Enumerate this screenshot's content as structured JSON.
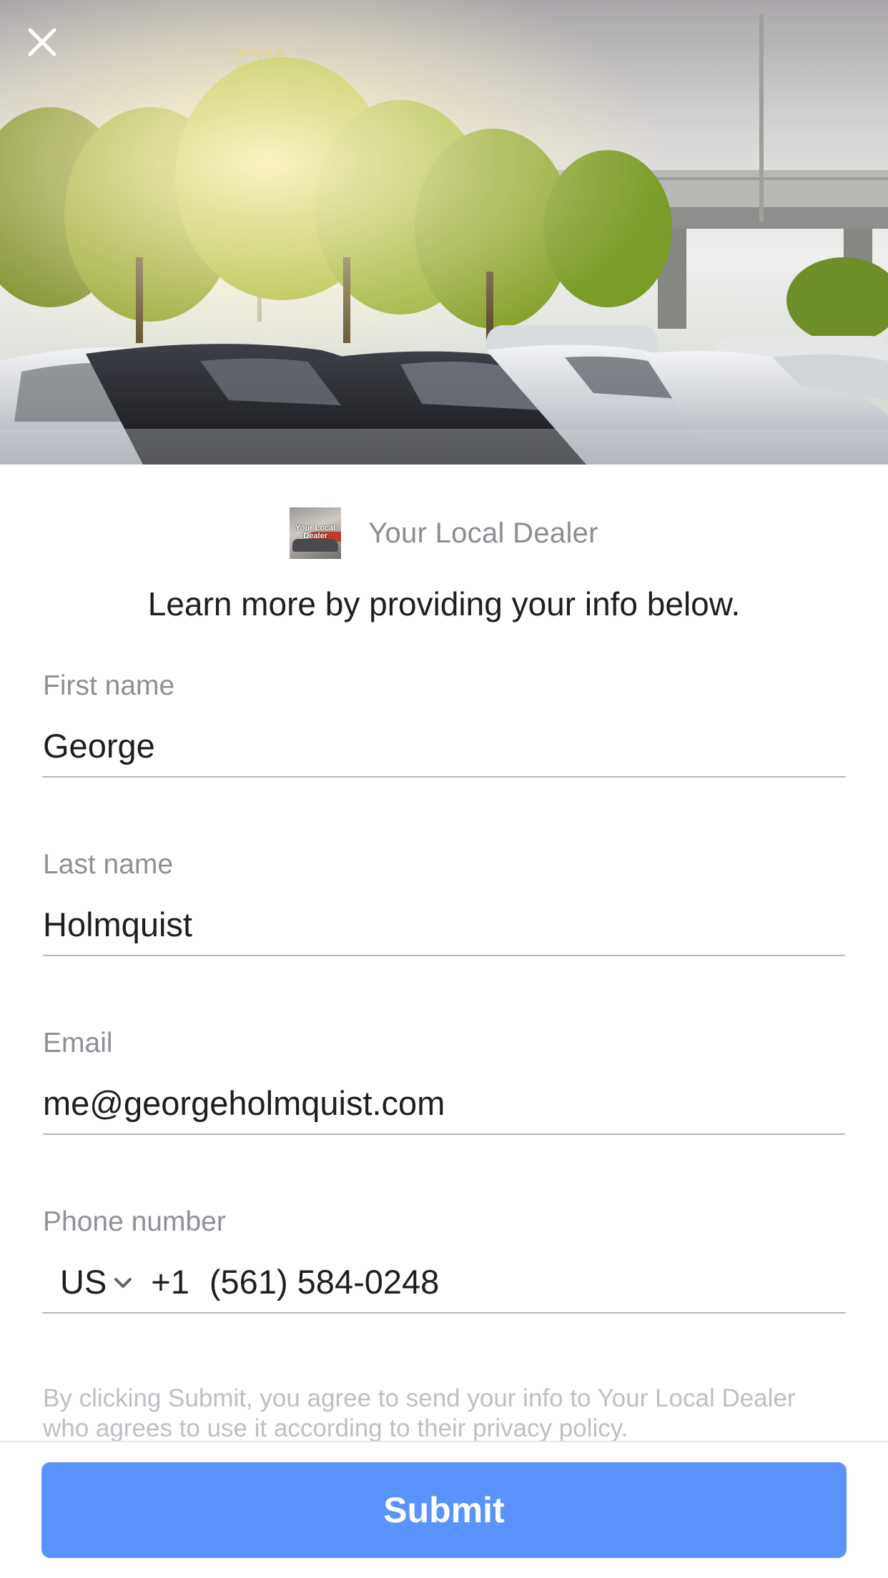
{
  "hero": {
    "close_icon": "close-icon"
  },
  "brand": {
    "name": "Your Local Dealer",
    "logo_text": "Your Local Dealer"
  },
  "form": {
    "subtitle": "Learn more by providing your info below.",
    "first_name": {
      "label": "First name",
      "value": "George"
    },
    "last_name": {
      "label": "Last name",
      "value": "Holmquist"
    },
    "email": {
      "label": "Email",
      "value": "me@georgeholmquist.com"
    },
    "phone": {
      "label": "Phone number",
      "country": "US",
      "dial_code": "+1",
      "value": "(561) 584-0248"
    },
    "disclaimer": "By clicking Submit, you agree to send your info to Your Local Dealer who agrees to use it according to their privacy policy."
  },
  "footer": {
    "submit_label": "Submit"
  },
  "colors": {
    "accent": "#5b93fd",
    "label": "#8d9096",
    "text": "#1c1e21",
    "disclaimer": "#bcc0c4"
  }
}
